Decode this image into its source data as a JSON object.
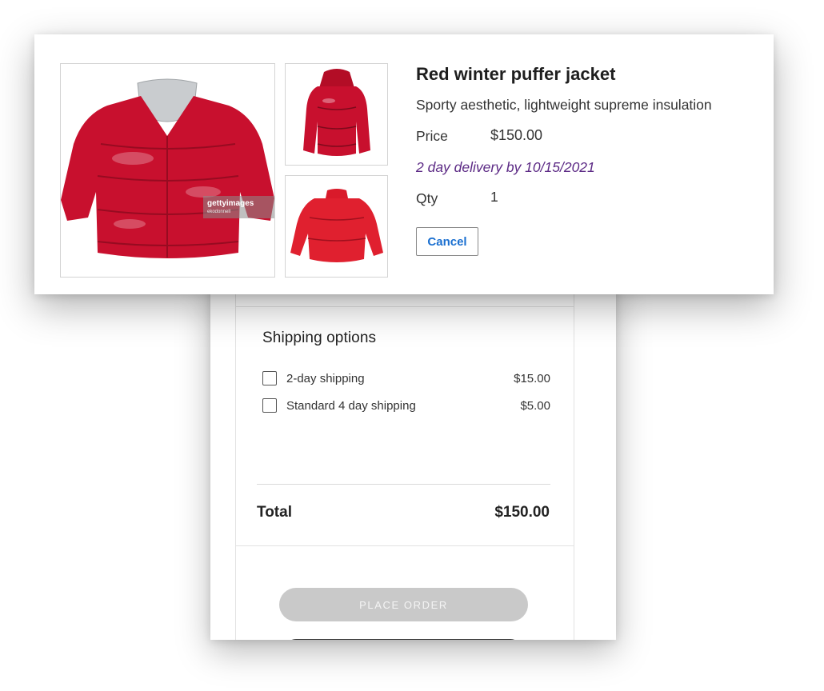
{
  "product": {
    "title": "Red winter puffer jacket",
    "description": "Sporty aesthetic, lightweight supreme insulation",
    "price_label": "Price",
    "price_value": "$150.00",
    "delivery": "2 day delivery by 10/15/2021",
    "qty_label": "Qty",
    "qty_value": "1",
    "cancel_label": "Cancel",
    "watermark_brand": "gettyimages",
    "watermark_credit": "ekodonnell",
    "jacket_color": "#c8102e",
    "delivery_color": "#5c2a85",
    "link_color": "#1a6fd0"
  },
  "checkout": {
    "shipping_title": "Shipping options",
    "options": [
      {
        "label": "2-day shipping",
        "price": "$15.00",
        "checked": false
      },
      {
        "label": "Standard 4 day shipping",
        "price": "$5.00",
        "checked": false
      }
    ],
    "total_label": "Total",
    "total_value": "$150.00",
    "place_order_label": "PLACE ORDER"
  }
}
